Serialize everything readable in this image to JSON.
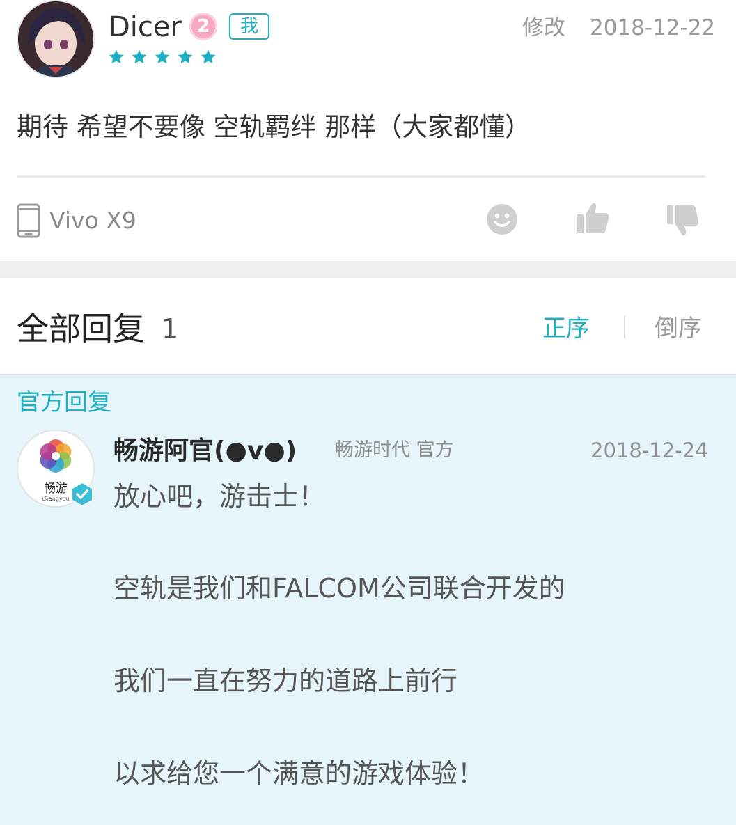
{
  "review": {
    "username": "Dicer",
    "level": "2",
    "me_tag": "我",
    "rating": 5,
    "edit_label": "修改",
    "date": "2018-12-22",
    "text": "期待 希望不要像 空轨羁绊 那样（大家都懂）",
    "device": "Vivo X9",
    "icons": {
      "device": "phone-icon",
      "reaction": "smiley-icon",
      "like": "thumbs-up-icon",
      "dislike": "thumbs-down-icon",
      "star": "star-icon"
    }
  },
  "replies": {
    "title": "全部回复",
    "count": "1",
    "sort_asc": "正序",
    "sort_desc": "倒序"
  },
  "official": {
    "label": "官方回复",
    "name": "畅游阿官(●v●)",
    "company": "畅游时代 官方",
    "date": "2018-12-24",
    "logo_text": "畅游",
    "logo_subtext": "changyou",
    "lines": [
      "放心吧，游击士！",
      "空轨是我们和FALCOM公司联合开发的",
      "我们一直在努力的道路上前行",
      "以求给您一个满意的游戏体验！"
    ]
  },
  "colors": {
    "accent": "#1fb0c4",
    "official_bg": "#e6f5f9",
    "level_badge": "#f7a8c4",
    "muted_text": "#9a9a9a"
  }
}
